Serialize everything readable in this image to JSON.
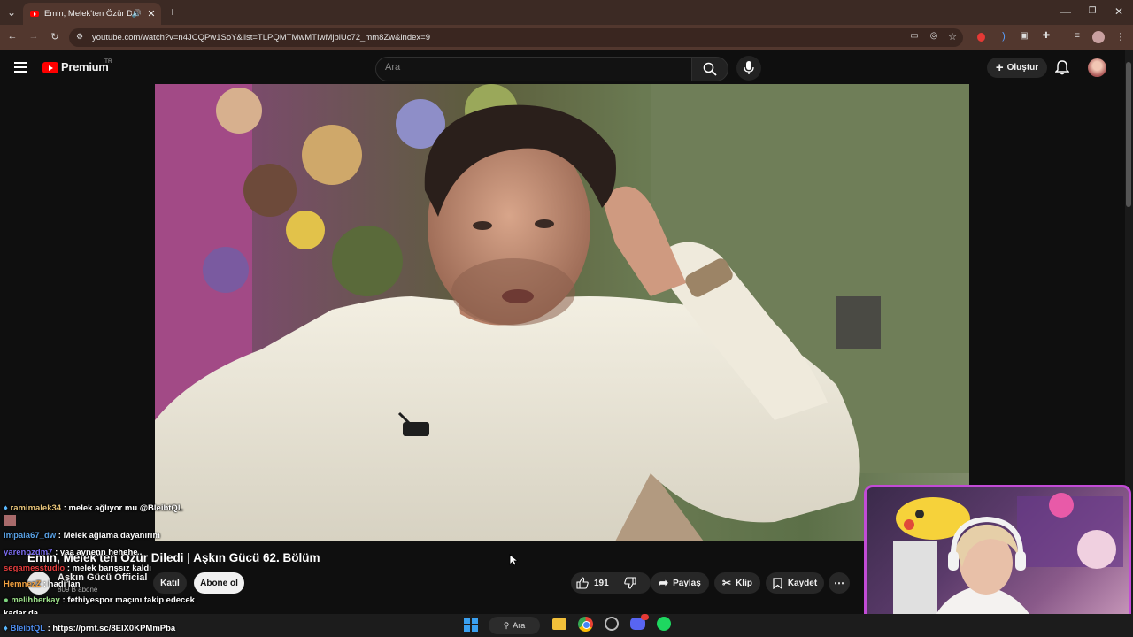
{
  "browser": {
    "tab_title": "Emin, Melek'ten Özür Diledi",
    "tab_close": "✕",
    "new_tab": "+",
    "url": "youtube.com/watch?v=n4JCQPw1SoY&list=TLPQMTMwMTIwMjbiUc72_mm8Zw&index=9"
  },
  "youtube": {
    "logo_text": "Premium",
    "logo_region": "TR",
    "search_placeholder": "Ara",
    "create_label": "Oluştur"
  },
  "video": {
    "title": "Emin, Melek'ten Özür Diledi | Aşkın Gücü 62. Bölüm",
    "channel_name": "Aşkın Gücü Official",
    "subscribers": "809 B abone",
    "join_label": "Katıl",
    "subscribe_label": "Abone ol",
    "like_count": "191",
    "share_label": "Paylaş",
    "clip_label": "Klip",
    "save_label": "Kaydet"
  },
  "chat": [
    {
      "user": "ramimalek34",
      "message": ": melek ağlıyor mu @BleibtQL"
    },
    {
      "user": "impala67_dw",
      "message": ": Melek ağlama dayanırım"
    },
    {
      "user": "yarenozdm7",
      "message": ": yaa aynenn hehehe"
    },
    {
      "user": "segamesstudio",
      "message": ": melek barışsız kaldı"
    },
    {
      "user": "HemnezZ",
      "message": ": hadi lan"
    },
    {
      "user": "melihberkay",
      "message": ": fethiyespor maçını takip edecek"
    },
    {
      "user": "",
      "message": "kadar da"
    },
    {
      "user": "BleibtQL",
      "message": ": https://prnt.sc/8ElX0KPMmPba"
    }
  ],
  "taskbar": {
    "search_label": "Ara"
  },
  "colors": {
    "youtube_red": "#ff0000",
    "webcam_border": "#c24bd6",
    "browser_frame": "#52372e"
  }
}
